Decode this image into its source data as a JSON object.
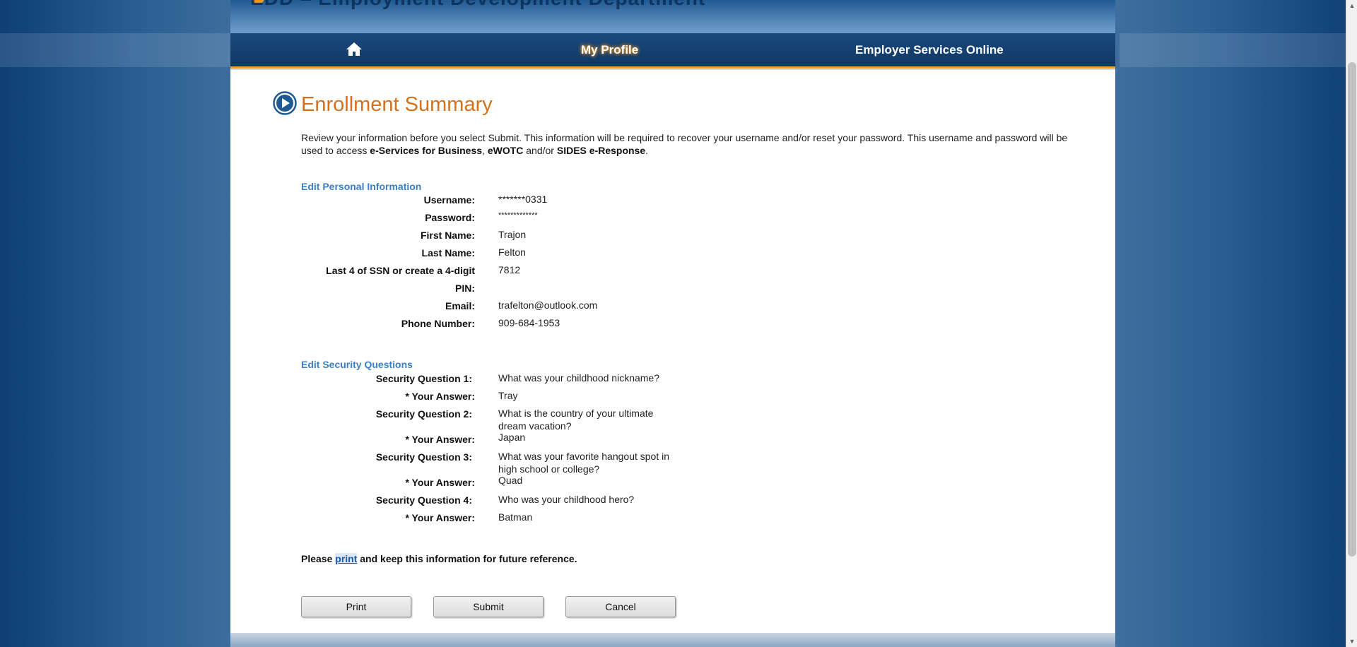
{
  "banner": {
    "title": "EDD – Employment Development Department"
  },
  "nav": {
    "home_icon": "home-icon",
    "items": [
      {
        "label": "My Profile"
      },
      {
        "label": "Employer Services Online"
      }
    ]
  },
  "page": {
    "title": "Enrollment Summary",
    "intro_text_1": "Review your information before you select Submit. This information will be required to recover your username and/or reset your password. This username and password will be used to access ",
    "intro_bold_1": "e-Services for Business",
    "intro_sep_1": ", ",
    "intro_bold_2": "eWOTC",
    "intro_sep_2": " and/or ",
    "intro_bold_3": "SIDES e-Response",
    "intro_end": "."
  },
  "personal": {
    "edit_link": "Edit Personal Information",
    "fields": [
      {
        "label": "Username:",
        "value": "*******0331"
      },
      {
        "label": "Password:",
        "value": "*************"
      },
      {
        "label": "First Name:",
        "value": "Trajon"
      },
      {
        "label": "Last Name:",
        "value": "Felton"
      },
      {
        "label": "Last 4 of SSN or create a 4-digit",
        "value": "7812"
      },
      {
        "label": "PIN:",
        "value": ""
      },
      {
        "label": "Email:",
        "value": "trafelton@outlook.com"
      },
      {
        "label": "Phone Number:",
        "value": "909-684-1953"
      }
    ]
  },
  "security": {
    "edit_link": "Edit Security Questions",
    "items": [
      {
        "label": "Security Question 1:",
        "value": "What was your childhood nickname?"
      },
      {
        "label": "* Your Answer:",
        "value": "Tray"
      },
      {
        "label": "Security Question 2:",
        "value": "What is the country of your ultimate dream vacation?"
      },
      {
        "label": "* Your Answer:",
        "value": "Japan"
      },
      {
        "label": "Security Question 3:",
        "value": "What was your favorite hangout spot in high school or college?"
      },
      {
        "label": "* Your Answer:",
        "value": "Quad"
      },
      {
        "label": "Security Question 4:",
        "value": "Who was your childhood hero?"
      },
      {
        "label": "* Your Answer:",
        "value": "Batman"
      }
    ]
  },
  "print_note": {
    "before": "Please ",
    "link": "print",
    "after": " and keep this information for future reference."
  },
  "buttons": {
    "print": "Print",
    "submit": "Submit",
    "cancel": "Cancel"
  },
  "colors": {
    "title": "#d4711c",
    "link": "#3b7fc4",
    "nav_bg": "#0f3764",
    "nav_accent": "#e4a137"
  }
}
